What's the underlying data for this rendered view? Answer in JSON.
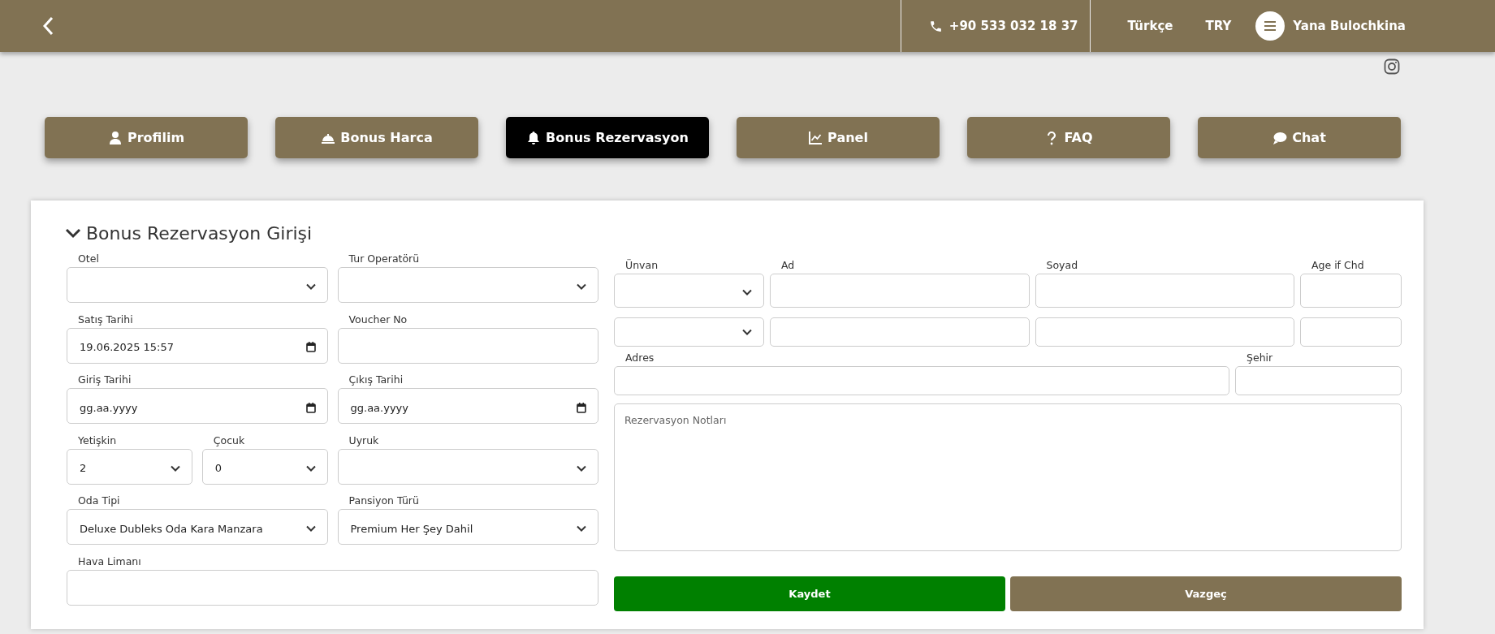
{
  "top_bar": {
    "phone": "+90 533 032 18 37",
    "language": "Türkçe",
    "currency": "TRY",
    "user_name": "Yana Bulochkina"
  },
  "tabs": [
    {
      "label": "Profilim",
      "selected": false
    },
    {
      "label": "Bonus Harca",
      "selected": false
    },
    {
      "label": "Bonus Rezervasyon",
      "selected": true
    },
    {
      "label": "Panel",
      "selected": false
    },
    {
      "label": "FAQ",
      "selected": false
    },
    {
      "label": "Chat",
      "selected": false
    }
  ],
  "form": {
    "title": "Bonus Rezervasyon Girişi",
    "expanded": true,
    "left_rows": [
      [
        {
          "kind": "select",
          "label": "Otel"
        },
        {
          "kind": "select",
          "label": "Tur Operatörü"
        }
      ],
      [
        {
          "kind": "date",
          "label": "Satış Tarihi",
          "value": "19.06.2025  15:57"
        },
        {
          "kind": "text",
          "label": "Voucher No"
        }
      ],
      [
        {
          "kind": "date",
          "label": "Giriş Tarihi",
          "placeholder": "gg.aa.yyyy"
        },
        {
          "kind": "date",
          "label": "Çıkış Tarihi",
          "placeholder": "gg.aa.yyyy"
        }
      ],
      [
        {
          "kind": "select",
          "label": "Yetişkin",
          "value": "2"
        },
        {
          "kind": "select",
          "label": "Çocuk",
          "value": "0"
        },
        {
          "kind": "select",
          "label": "Uyruk"
        }
      ],
      [
        {
          "kind": "select",
          "label": "Oda Tipi",
          "value": "Deluxe Dubleks Oda Kara Manzara"
        },
        {
          "kind": "select",
          "label": "Pansiyon Türü",
          "value": "Premium Her Şey Dahil"
        }
      ],
      [
        {
          "kind": "text",
          "label": "Hava Limanı"
        }
      ]
    ],
    "guest_rows": [
      [
        {
          "kind": "select",
          "label": "Ünvan"
        },
        {
          "kind": "text",
          "label": "Ad"
        },
        {
          "kind": "text",
          "label": "Soyad"
        },
        {
          "kind": "text",
          "label": "Age if Chd"
        }
      ],
      [
        {
          "kind": "select"
        },
        {
          "kind": "text"
        },
        {
          "kind": "text"
        },
        {
          "kind": "text"
        }
      ]
    ],
    "address_row": [
      {
        "kind": "text",
        "label": "Adres"
      },
      {
        "kind": "text",
        "label": "Şehir"
      }
    ],
    "notes": {
      "placeholder": "Rezervasyon Notları"
    },
    "buttons": [
      {
        "label": "Kaydet",
        "kind": "primary"
      },
      {
        "label": "Vazgeç",
        "kind": "secondary"
      }
    ]
  }
}
